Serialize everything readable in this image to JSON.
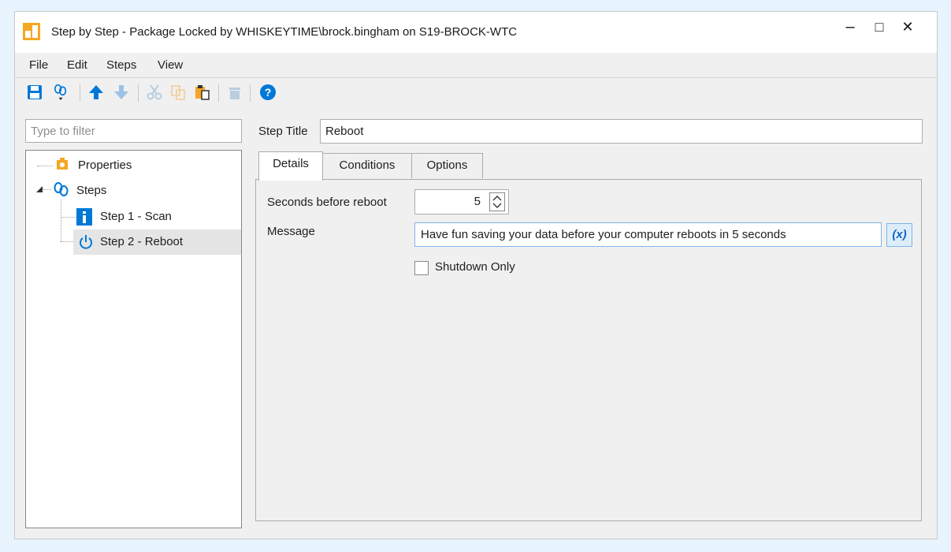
{
  "window": {
    "title": "Step by Step - Package Locked by WHISKEYTIME\\brock.bingham on S19-BROCK-WTC",
    "minimize": "–",
    "maximize": "□",
    "close": "✕"
  },
  "menu": [
    "File",
    "Edit",
    "Steps",
    "View"
  ],
  "toolbar": {
    "icons": [
      "save-icon",
      "steps-dropdown-icon",
      "move-up-icon",
      "move-down-icon",
      "cut-icon",
      "copy-icon",
      "paste-icon",
      "delete-icon",
      "help-icon"
    ]
  },
  "filter": {
    "placeholder": "Type to filter",
    "value": ""
  },
  "tree": {
    "properties": "Properties",
    "steps": "Steps",
    "items": [
      "Step 1 - Scan",
      "Step 2 - Reboot"
    ],
    "selected": "Step 2 - Reboot"
  },
  "step_title": {
    "label": "Step Title",
    "value": "Reboot"
  },
  "tabs": [
    "Details",
    "Conditions",
    "Options"
  ],
  "active_tab": "Details",
  "details": {
    "seconds_label": "Seconds before reboot",
    "seconds_value": "5",
    "message_label": "Message",
    "message_value": "Have fun saving your data before your computer reboots in 5 seconds",
    "variable_button": "(x)",
    "shutdown_label": "Shutdown Only",
    "shutdown_checked": false
  },
  "colors": {
    "accent_blue": "#0078d7",
    "icon_orange": "#f5a623",
    "background": "#e8f4fd"
  }
}
